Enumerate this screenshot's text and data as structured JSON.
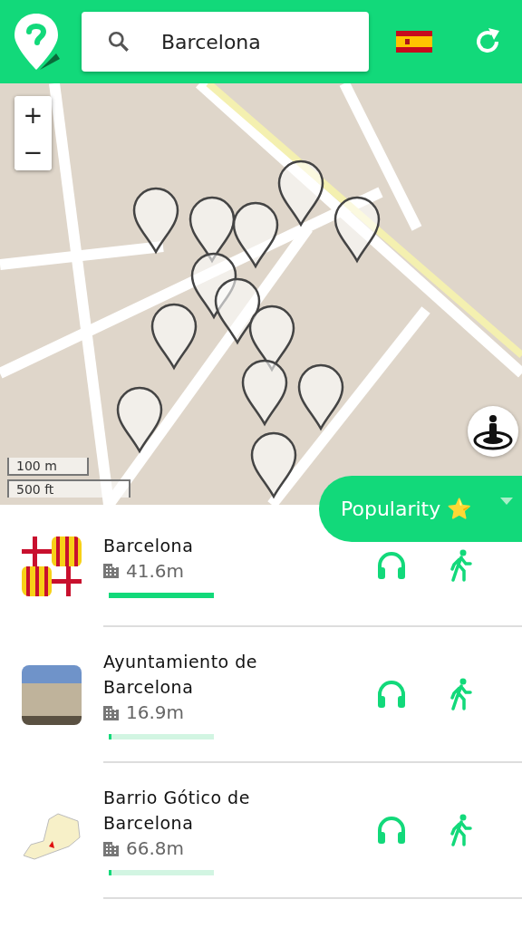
{
  "search": {
    "value": "Barcelona"
  },
  "map": {
    "zoom_in": "+",
    "zoom_out": "−",
    "scale": [
      "100 m",
      "500 ft"
    ]
  },
  "sort_button": {
    "label": "Popularity ⭐"
  },
  "places": [
    {
      "title": "Barcelona",
      "distance": "41.6m",
      "level": 1.0,
      "kind": "emblem"
    },
    {
      "title": "Ayuntamiento de Barcelona",
      "distance": "16.9m",
      "level": 0.03,
      "kind": "photo"
    },
    {
      "title": "Barrio Gótico de Barcelona",
      "distance": "66.8m",
      "level": 0.03,
      "kind": "map"
    }
  ]
}
